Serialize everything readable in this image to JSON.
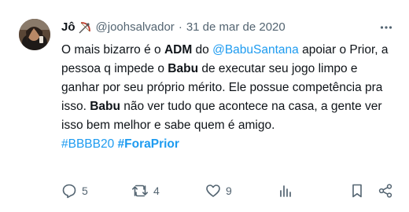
{
  "tweet": {
    "author": {
      "name": "Jô",
      "handle": "@joohsalvador",
      "name_emoji": "bow-and-arrow-emoji"
    },
    "separator": "·",
    "date": "31 de mar de 2020",
    "text": {
      "p1": "O mais bizarro é o ",
      "adm": "ADM",
      "p2": " do ",
      "mention": "@BabuSantana",
      "p3": " apoiar o Prior, a pessoa q impede o ",
      "babu1": "Babu",
      "p4": " de executar seu jogo limpo e ganhar por seu próprio mérito. Ele possue competência pra isso. ",
      "babu2": "Babu",
      "p5": " não ver tudo que acontece na casa, a gente ver isso bem melhor e sabe quem é amigo."
    },
    "hashtags": [
      "#BBBB20",
      "#ForaPrior"
    ],
    "stats": {
      "replies": "5",
      "retweets": "4",
      "likes": "9"
    },
    "colors": {
      "link": "#1d9bf0",
      "secondary": "#536471",
      "text": "#0f1419"
    }
  }
}
